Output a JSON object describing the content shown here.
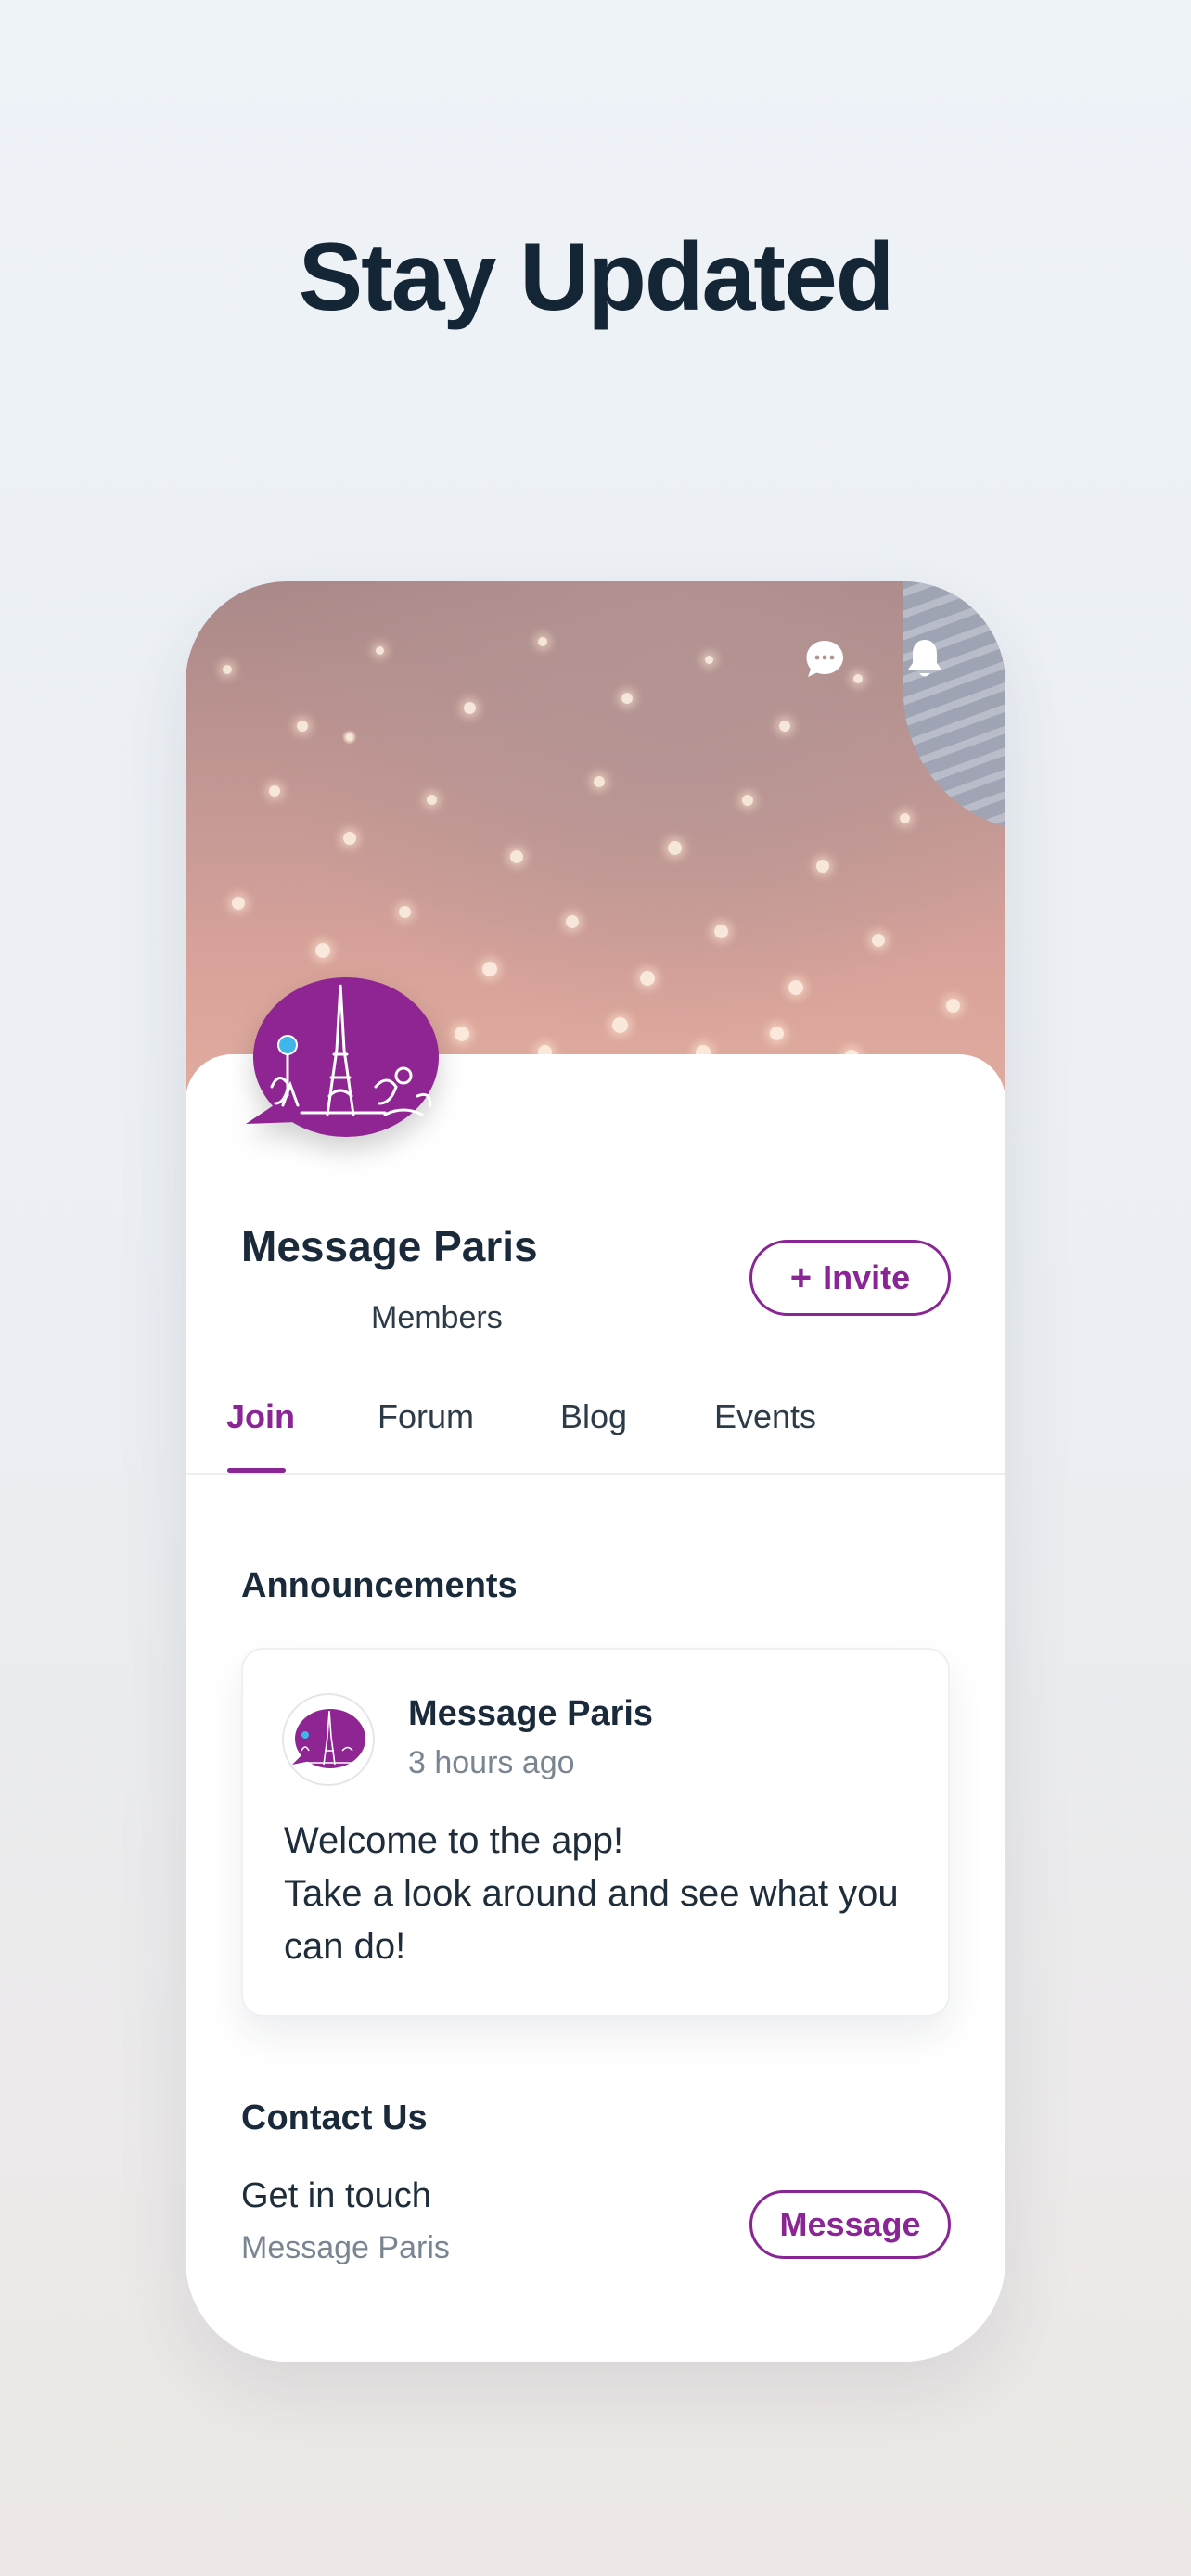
{
  "headline": "Stay Updated",
  "header": {
    "icons": [
      "chat-icon",
      "bell-icon"
    ]
  },
  "group": {
    "name": "Message Paris",
    "members_label": "Members",
    "invite_label": "Invite"
  },
  "tabs": [
    {
      "label": "Join",
      "active": true
    },
    {
      "label": "Forum",
      "active": false
    },
    {
      "label": "Blog",
      "active": false
    },
    {
      "label": "Events",
      "active": false
    }
  ],
  "announcements": {
    "title": "Announcements",
    "post": {
      "author": "Message Paris",
      "time": "3 hours ago",
      "body_line1": "Welcome to the app!",
      "body_line2": "Take a look around and see what you can do!"
    }
  },
  "contact": {
    "title": "Contact Us",
    "line": "Get in touch",
    "sub": "Message Paris",
    "button_label": "Message"
  },
  "colors": {
    "accent": "#8a2596",
    "text": "#1b2a3a",
    "muted": "#7a8592"
  }
}
